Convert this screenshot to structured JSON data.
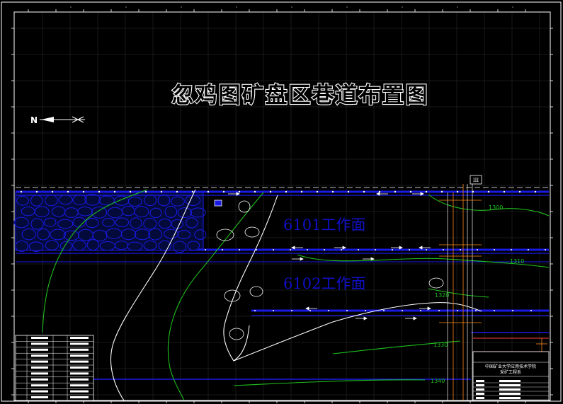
{
  "drawing": {
    "title": "忽鸡图矿盘区巷道布置图",
    "compass_label": "N",
    "faces": [
      {
        "label": "6101工作面"
      },
      {
        "label": "6102工作面"
      }
    ],
    "contours": [
      {
        "label": "1300"
      },
      {
        "label": "1310"
      },
      {
        "label": "1320"
      },
      {
        "label": "1330"
      },
      {
        "label": "1340"
      }
    ],
    "shaft_marker": "III",
    "title_block": {
      "school": "中国矿业大学应用技术学院",
      "dept": "采矿工程系"
    },
    "colors": {
      "background": "#000000",
      "frame": "#ffffff",
      "roadway": "#1a1ae6",
      "gob": "#0a1a8c",
      "contour_green": "#1fc01f",
      "fault_white": "#ffffff",
      "title_fill": "#000000",
      "face_label": "#1010c8",
      "grid": "#202020"
    }
  }
}
